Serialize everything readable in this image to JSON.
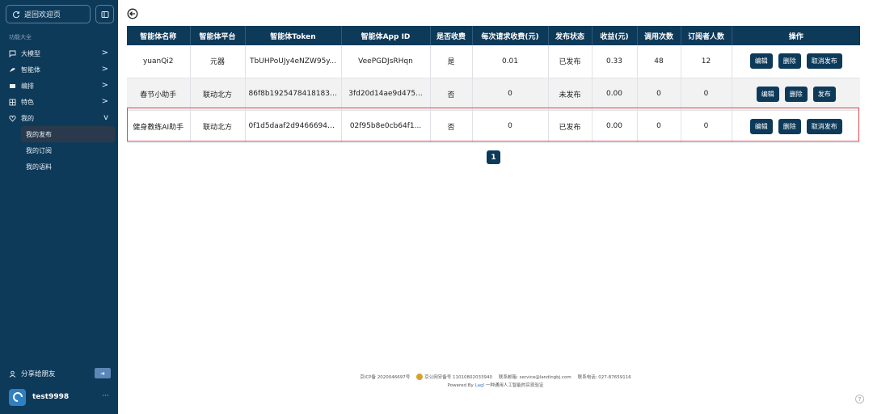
{
  "sidebar": {
    "back_label": "返回欢迎页",
    "section_label": "功能大全",
    "items": [
      {
        "label": "大模型",
        "icon": "chat-icon",
        "chevron": ">"
      },
      {
        "label": "智能体",
        "icon": "bot-icon",
        "chevron": ">"
      },
      {
        "label": "编排",
        "icon": "layout-icon",
        "chevron": ">"
      },
      {
        "label": "特色",
        "icon": "grid-icon",
        "chevron": ">"
      },
      {
        "label": "我的",
        "icon": "heart-icon",
        "chevron": "v"
      }
    ],
    "subitems": [
      {
        "label": "我的发布",
        "active": true
      },
      {
        "label": "我的订阅",
        "active": false
      },
      {
        "label": "我的语料",
        "active": false
      }
    ],
    "share_label": "分享给朋友",
    "username": "test9998",
    "more": "···"
  },
  "table": {
    "headers": [
      "智能体名称",
      "智能体平台",
      "智能体Token",
      "智能体App ID",
      "是否收费",
      "每次请求收费(元)",
      "发布状态",
      "收益(元)",
      "调用次数",
      "订阅者人数",
      "操作"
    ],
    "rows": [
      {
        "name": "yuanQi2",
        "platform": "元器",
        "token": "TbUHPoUJy4eNZW95y...",
        "app_id": "VeePGDJsRHqn",
        "paid": "是",
        "fee": "0.01",
        "status": "已发布",
        "revenue": "0.33",
        "calls": "48",
        "subscribers": "12",
        "actions": [
          "编辑",
          "删除",
          "取消发布"
        ]
      },
      {
        "name": "春节小助手",
        "platform": "联动北方",
        "token": "86f8b1925478418183b...",
        "app_id": "3fd20d14ae9d475...",
        "paid": "否",
        "fee": "0",
        "status": "未发布",
        "revenue": "0.00",
        "calls": "0",
        "subscribers": "0",
        "actions": [
          "编辑",
          "删除",
          "发布"
        ]
      },
      {
        "name": "健身教练AI助手",
        "platform": "联动北方",
        "token": "0f1d5daaf2d94666948...",
        "app_id": "02f95b8e0cb64f1...",
        "paid": "否",
        "fee": "0",
        "status": "已发布",
        "revenue": "0.00",
        "calls": "0",
        "subscribers": "0",
        "actions": [
          "编辑",
          "删除",
          "取消发布"
        ]
      }
    ]
  },
  "pagination": {
    "current": "1"
  },
  "footer": {
    "icp": "京ICP备 2020046697号",
    "police": "京公网安备号 11010802033940",
    "email": "联系邮箱: service@landingbj.com",
    "phone": "联系电话: 027-87659116",
    "powered_prefix": "Powered By",
    "powered_link": "LagI",
    "powered_suffix": "一种通用人工智能的实现验证"
  },
  "help": "?",
  "colors": {
    "sidebar": "#0e3a5a",
    "header": "#0e3a5a",
    "button": "#0e3a5a",
    "highlight": "#e0484e"
  }
}
